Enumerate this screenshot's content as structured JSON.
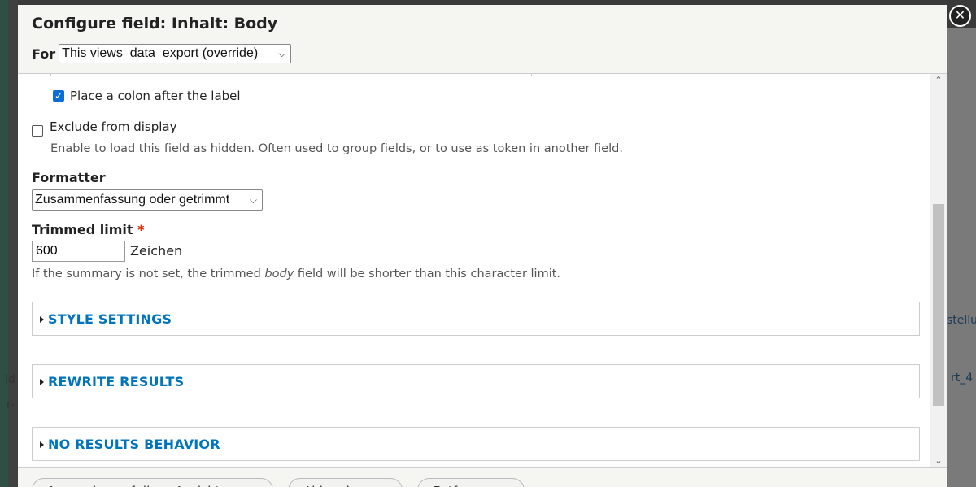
{
  "dialog": {
    "title": "Configure field: Inhalt: Body",
    "for_label": "For",
    "for_select_value": "This views_data_export (override)"
  },
  "form": {
    "colon_checkbox_label": "Place a colon after the label",
    "colon_checked": true,
    "exclude_label": "Exclude from display",
    "exclude_checked": false,
    "exclude_description": "Enable to load this field as hidden. Often used to group fields, or to use as token in another field.",
    "formatter_label": "Formatter",
    "formatter_value": "Zusammenfassung oder getrimmt",
    "trimmed_limit_label": "Trimmed limit",
    "required_marker": "*",
    "trimmed_limit_value": "600",
    "trimmed_limit_suffix": "Zeichen",
    "trimmed_desc_before": "If the summary is not set, the trimmed ",
    "trimmed_desc_em": "body",
    "trimmed_desc_after": " field will be shorter than this character limit."
  },
  "sections": {
    "style": "STYLE SETTINGS",
    "rewrite": "REWRITE RESULTS",
    "no_results": "NO RESULTS BEHAVIOR"
  },
  "buttons": {
    "apply": "Anwenden auf diese Ansicht",
    "cancel": "Abbrechen",
    "remove": "Entfernen"
  },
  "background": {
    "right_text_1": "stellu",
    "right_text_2": "rt_4",
    "left_text_1": "ld",
    "left_text_2": "r-"
  },
  "icons": {
    "close": "close-icon",
    "checkmark": "checkmark-icon",
    "chevron": "chevron-down-icon",
    "triangle": "triangle-right-icon"
  },
  "colors": {
    "link": "#0074bd",
    "checkbox": "#0b6dd6",
    "required": "#e62600"
  }
}
